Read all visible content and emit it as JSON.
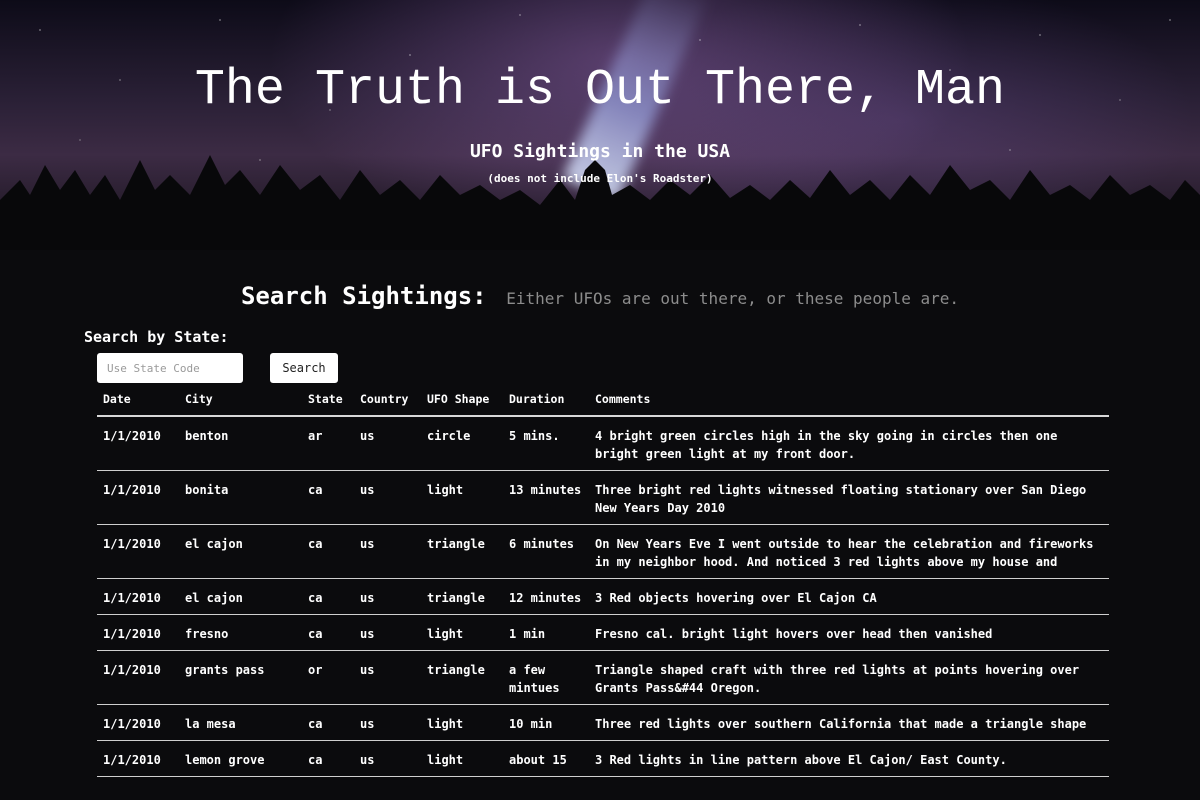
{
  "hero": {
    "title": "The Truth is Out There, Man",
    "subtitle": "UFO Sightings in the USA",
    "note": "(does not include Elon's Roadster)"
  },
  "search": {
    "heading": "Search Sightings:",
    "tagline": "Either UFOs are out there, or these people are.",
    "state_label": "Search by State:",
    "input_placeholder": "Use State Code",
    "input_value": "",
    "button_label": "Search"
  },
  "table": {
    "columns": [
      "Date",
      "City",
      "State",
      "Country",
      "UFO Shape",
      "Duration",
      "Comments"
    ],
    "rows": [
      [
        "1/1/2010",
        "benton",
        "ar",
        "us",
        "circle",
        "5 mins.",
        "4 bright green circles high in the sky going in circles then one bright green light at my front door."
      ],
      [
        "1/1/2010",
        "bonita",
        "ca",
        "us",
        "light",
        "13 minutes",
        "Three bright red lights witnessed floating stationary over San Diego New Years Day 2010"
      ],
      [
        "1/1/2010",
        "el cajon",
        "ca",
        "us",
        "triangle",
        "6 minutes",
        "On New Years Eve I went outside to hear the celebration and fireworks in my neighbor hood. And noticed 3 red lights above my house and"
      ],
      [
        "1/1/2010",
        "el cajon",
        "ca",
        "us",
        "triangle",
        "12 minutes",
        "3 Red objects hovering over El Cajon CA"
      ],
      [
        "1/1/2010",
        "fresno",
        "ca",
        "us",
        "light",
        "1 min",
        "Fresno cal. bright light hovers over head then vanished"
      ],
      [
        "1/1/2010",
        "grants pass",
        "or",
        "us",
        "triangle",
        "a few mintues",
        "Triangle shaped craft with three red lights at points hovering over Grants Pass&#44 Oregon."
      ],
      [
        "1/1/2010",
        "la mesa",
        "ca",
        "us",
        "light",
        "10 min",
        "Three red lights over southern California that made a triangle shape"
      ],
      [
        "1/1/2010",
        "lemon grove",
        "ca",
        "us",
        "light",
        "about 15",
        "3 Red lights in line pattern above El Cajon/ East County."
      ]
    ]
  }
}
